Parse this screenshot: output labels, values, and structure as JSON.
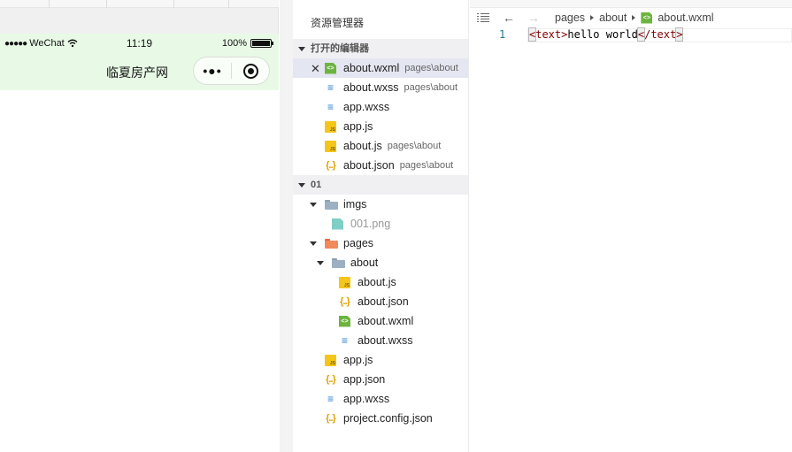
{
  "simulator": {
    "status": {
      "signal": "●●●●●",
      "carrier": "WeChat",
      "time": "11:19",
      "battery": "100%"
    },
    "nav": {
      "title": "临夏房产网",
      "more": "•●•"
    }
  },
  "explorer": {
    "title": "资源管理器",
    "open_editors": {
      "label": "打开的编辑器",
      "items": [
        {
          "name": "about.wxml",
          "path": "pages\\about",
          "icon": "wxml-file-icon"
        },
        {
          "name": "about.wxss",
          "path": "pages\\about",
          "icon": "wxss-file-icon"
        },
        {
          "name": "app.wxss",
          "path": "",
          "icon": "wxss-file-icon"
        },
        {
          "name": "app.js",
          "path": "",
          "icon": "js-file-icon"
        },
        {
          "name": "about.js",
          "path": "pages\\about",
          "icon": "js-file-icon"
        },
        {
          "name": "about.json",
          "path": "pages\\about",
          "icon": "json-file-icon"
        }
      ]
    },
    "project": {
      "label": "01",
      "tree": {
        "imgs": "imgs",
        "png": "001.png",
        "pages": "pages",
        "about": "about",
        "about_js": "about.js",
        "about_json": "about.json",
        "about_wxml": "about.wxml",
        "about_wxss": "about.wxss",
        "app_js": "app.js",
        "app_json": "app.json",
        "app_wxss": "app.wxss",
        "project_config": "project.config.json"
      }
    }
  },
  "editor": {
    "breadcrumb": [
      "pages",
      "about",
      "about.wxml"
    ],
    "line_number": "1",
    "code": {
      "open_lt": "<",
      "open_tag": "text",
      "open_gt": ">",
      "text": "hello world",
      "close_lt": "<",
      "close_tag": "/text",
      "close_gt": ">"
    }
  },
  "colors": {
    "nav_bg": "#e8fae6",
    "active_row": "#e4e6f1",
    "tag": "#800000",
    "line_number": "#237893"
  }
}
